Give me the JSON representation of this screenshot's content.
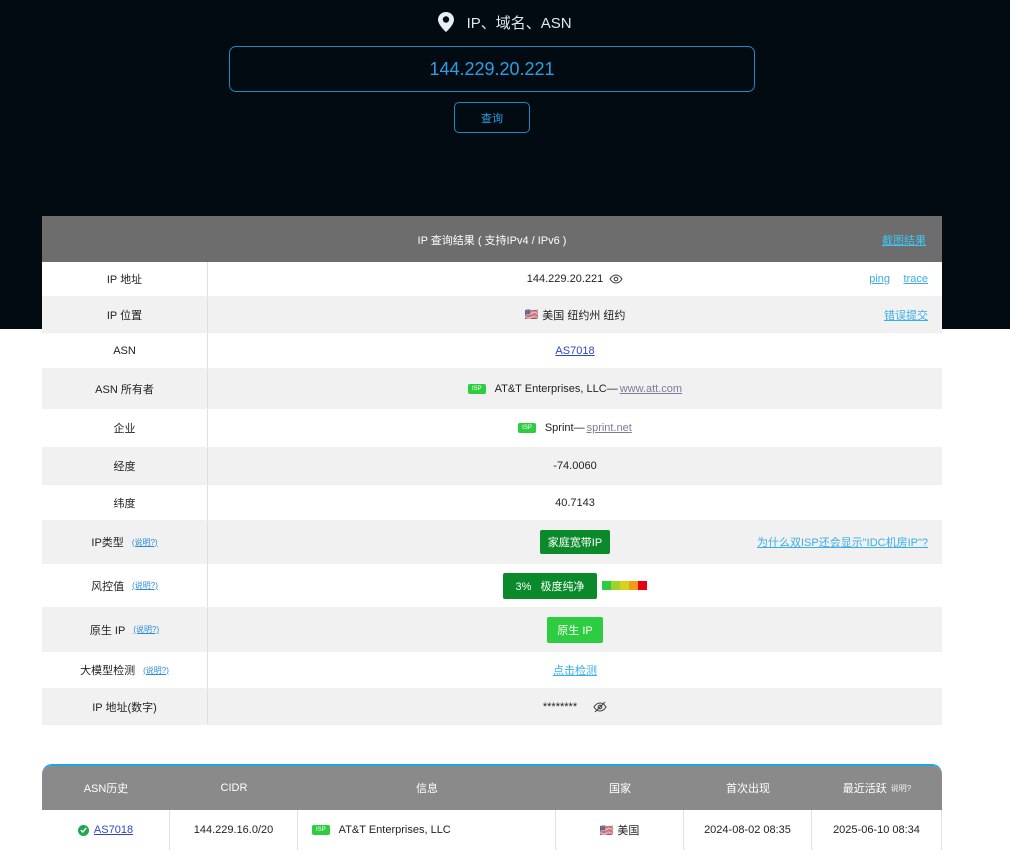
{
  "search": {
    "label": "IP、域名、ASN",
    "value": "144.229.20.221",
    "button": "查询"
  },
  "result": {
    "title": "IP 查询结果 ( 支持IPv4 / IPv6 )",
    "screenshot_link": "截图结果",
    "rows": {
      "ip": {
        "key": "IP 地址",
        "value": "144.229.20.221",
        "ping": "ping",
        "trace": "trace"
      },
      "location": {
        "key": "IP 位置",
        "flag": "🇺🇸",
        "value": "美国 纽约州 纽约",
        "report": "错误提交"
      },
      "asn": {
        "key": "ASN",
        "value": "AS7018"
      },
      "asn_owner": {
        "key": "ASN 所有者",
        "tag": "ISP",
        "name": "AT&T Enterprises, LLC—",
        "domain": "www.att.com"
      },
      "company": {
        "key": "企业",
        "tag": "ISP",
        "name": "Sprint—",
        "domain": "sprint.net"
      },
      "longitude": {
        "key": "经度",
        "value": "-74.0060"
      },
      "latitude": {
        "key": "纬度",
        "value": "40.7143"
      },
      "ip_type": {
        "key": "IP类型",
        "hint": "(说明?)",
        "value": "家庭宽带IP",
        "why": "为什么双ISP还会显示\"IDC机房IP\"?"
      },
      "risk": {
        "key": "风控值",
        "hint": "(说明?)",
        "value": "3%   极度纯净",
        "colors": [
          "#2ecc40",
          "#9ed42a",
          "#d7d11a",
          "#f39c12",
          "#e60012"
        ]
      },
      "native": {
        "key": "原生 IP",
        "hint": "(说明?)",
        "value": "原生 IP"
      },
      "llm": {
        "key": "大模型检测",
        "hint": "(说明?)",
        "value": "点击检测"
      },
      "numeric": {
        "key": "IP 地址(数字)",
        "value": "********"
      }
    }
  },
  "history": {
    "headers": [
      "ASN历史",
      "CIDR",
      "信息",
      "国家",
      "首次出现",
      "最近活跃"
    ],
    "last_active_hint": "说明?",
    "rows": [
      {
        "asn": "AS7018",
        "cidr": "144.229.16.0/20",
        "tag": "ISP",
        "info": "AT&T Enterprises, LLC",
        "flag": "🇺🇸",
        "country": "美国",
        "first_seen": "2024-08-02 08:35",
        "last_active": "2025-06-10 08:34"
      }
    ]
  },
  "colors": {
    "hero_bg": "#020a12",
    "accent": "#1f89c6",
    "header_gray": "#6d6d6d",
    "green_dark": "#0a8a2a",
    "green_bright": "#2ecc40"
  }
}
